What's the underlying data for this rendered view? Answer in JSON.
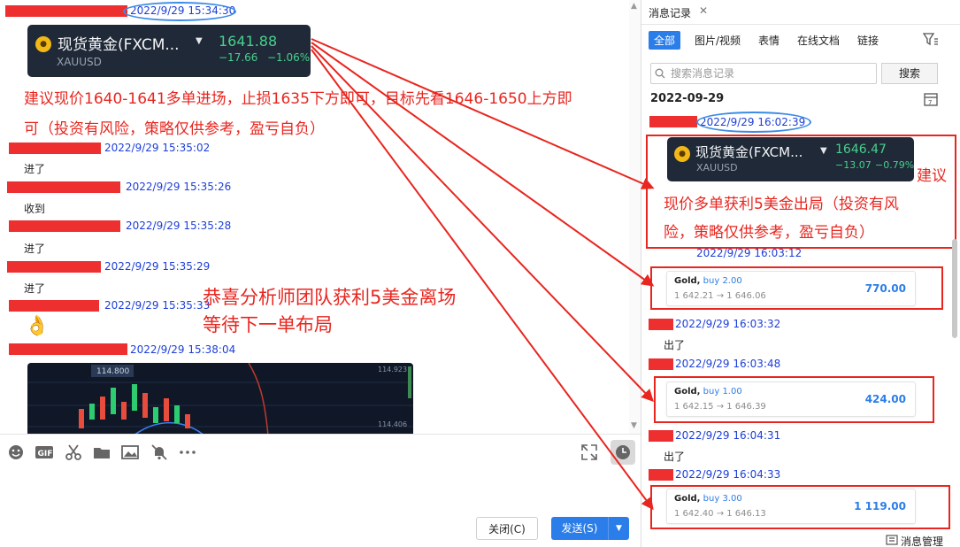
{
  "chat": {
    "messages": [
      {
        "time": "2022/9/29 15:34:30"
      },
      {
        "time": "2022/9/29 15:35:02",
        "text": "进了"
      },
      {
        "time": "2022/9/29 15:35:26",
        "text": "收到"
      },
      {
        "time": "2022/9/29 15:35:28",
        "text": "进了"
      },
      {
        "time": "2022/9/29 15:35:29",
        "text": "进了"
      },
      {
        "time": "2022/9/29 15:35:33",
        "emoji": "👌"
      },
      {
        "time": "2022/9/29 15:38:04"
      }
    ],
    "quote_card": {
      "name": "现货黄金(FXCM...",
      "symbol": "XAUUSD",
      "price": "1641.88",
      "change": "−17.66",
      "change_pct": "−1.06%"
    },
    "advice_line1": "建议现价1640-1641多单进场，止损1635下方即可，目标先看1646-1650上方即",
    "advice_line2": "可（投资有风险，策略仅供参考，盈亏自负）",
    "congrats_line1": "恭喜分析师团队获利5美金离场",
    "congrats_line2": "等待下一单布局",
    "chart_ticks": {
      "top_label": "114.800",
      "right_top": "114.923",
      "right_mid": "114.406"
    }
  },
  "composer": {
    "close_label": "关闭(C)",
    "send_label": "发送(S)"
  },
  "side": {
    "tab_label": "消息记录",
    "filters": [
      "全部",
      "图片/视频",
      "表情",
      "在线文档",
      "链接"
    ],
    "search_placeholder": "搜索消息记录",
    "search_button": "搜索",
    "date": "2022-09-29",
    "first_time": "2022/9/29 16:02:39",
    "quote_card": {
      "name": "现货黄金(FXCM...",
      "symbol": "XAUUSD",
      "price": "1646.47",
      "change": "−13.07",
      "change_pct": "−0.79%"
    },
    "advice_word": "建议",
    "advice_line1": "现价多单获利5美金出局（投资有风",
    "advice_line2": "险，策略仅供参考，盈亏自负）",
    "entries": [
      {
        "time": "2022/9/29 16:03:12",
        "trade": {
          "asset": "Gold,",
          "side": "buy 2.00",
          "prices": "1 642.21 → 1 646.06",
          "pnl": "770.00"
        }
      },
      {
        "time": "2022/9/29 16:03:32",
        "text": "出了"
      },
      {
        "time": "2022/9/29 16:03:48",
        "trade": {
          "asset": "Gold,",
          "side": "buy 1.00",
          "prices": "1 642.15 → 1 646.39",
          "pnl": "424.00"
        }
      },
      {
        "time": "2022/9/29 16:04:31",
        "text": "出了"
      },
      {
        "time": "2022/9/29 16:04:33",
        "trade": {
          "asset": "Gold,",
          "side": "buy 3.00",
          "prices": "1 642.40 → 1 646.13",
          "pnl": "1 119.00"
        }
      }
    ],
    "manage_label": "消息管理"
  },
  "colors": {
    "annotation_red": "#e8261f",
    "timestamp_blue": "#1d3fd8",
    "accent_blue": "#2b7de9",
    "quote_green": "#47d18c"
  },
  "icons": [
    "emoji-icon",
    "gif-icon",
    "scissors-icon",
    "folder-icon",
    "image-icon",
    "mute-bell-icon",
    "more-icon",
    "expand-icon",
    "history-icon",
    "close-icon",
    "calendar-icon",
    "filter-icon",
    "search-icon",
    "message-manage-icon"
  ]
}
